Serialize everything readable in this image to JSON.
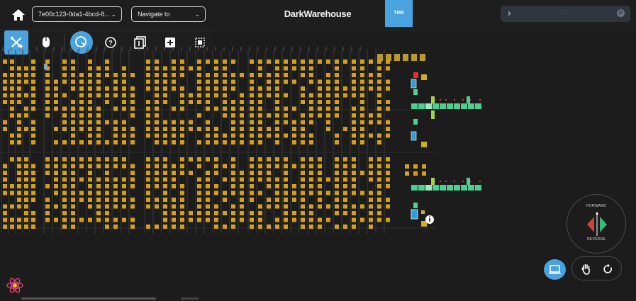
{
  "header": {
    "brand": "DarkWarehouse",
    "session_select_value": "7e00c123-0da1-4bcd-8...",
    "navigate_select_value": "Navigate to",
    "tms_label": "TMS",
    "player_dots": ":::"
  },
  "toolbar": {
    "items": [
      "tools-icon",
      "mouse-icon",
      "cursor-target-icon",
      "help-icon",
      "layer-one-icon",
      "add-box-icon",
      "select-area-icon"
    ],
    "active": "tools-icon"
  },
  "steering": {
    "forward_label": "FORWARD",
    "reverse_label": "REVERSE"
  },
  "controls": {
    "view_icon": "laptop-icon",
    "pan_icon": "hand-icon",
    "reset_icon": "rotate-icon"
  },
  "colors": {
    "background": "#1c1c1c",
    "accent": "#4aa3df",
    "rack_slot": "#d4a017",
    "rack_slot_dim": "#b89a2a",
    "conveyor": "#4fcf8f",
    "conveyor_light": "#9fe8c0",
    "vehicle": "#2a9fd8",
    "alert": "#e03030"
  }
}
